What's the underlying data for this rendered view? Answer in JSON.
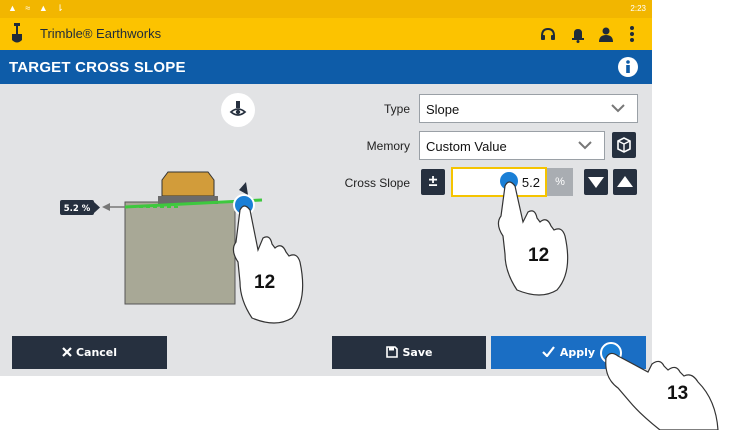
{
  "status_bar": {
    "time": "2:23"
  },
  "app_bar": {
    "title": "Trimble® Earthworks"
  },
  "page": {
    "title": "TARGET CROSS SLOPE"
  },
  "diagram": {
    "slope_tag": "5.2 %"
  },
  "form": {
    "type": {
      "label": "Type",
      "value": "Slope"
    },
    "memory": {
      "label": "Memory",
      "value": "Custom Value"
    },
    "cross_slope": {
      "label": "Cross Slope",
      "plus_minus": "±",
      "value": "5.2",
      "unit": "%"
    }
  },
  "buttons": {
    "cancel": "Cancel",
    "save": "Save",
    "apply": "Apply"
  },
  "callouts": {
    "hand_left": "12",
    "hand_middle": "12",
    "hand_right": "13"
  },
  "colors": {
    "appbar": "#fcc300",
    "titlebar": "#0e5ca8",
    "dark_button": "#26303f",
    "apply_button": "#1a6ec4",
    "touch_marker": "#1a7fd6",
    "slope_line": "#3ec83e"
  }
}
